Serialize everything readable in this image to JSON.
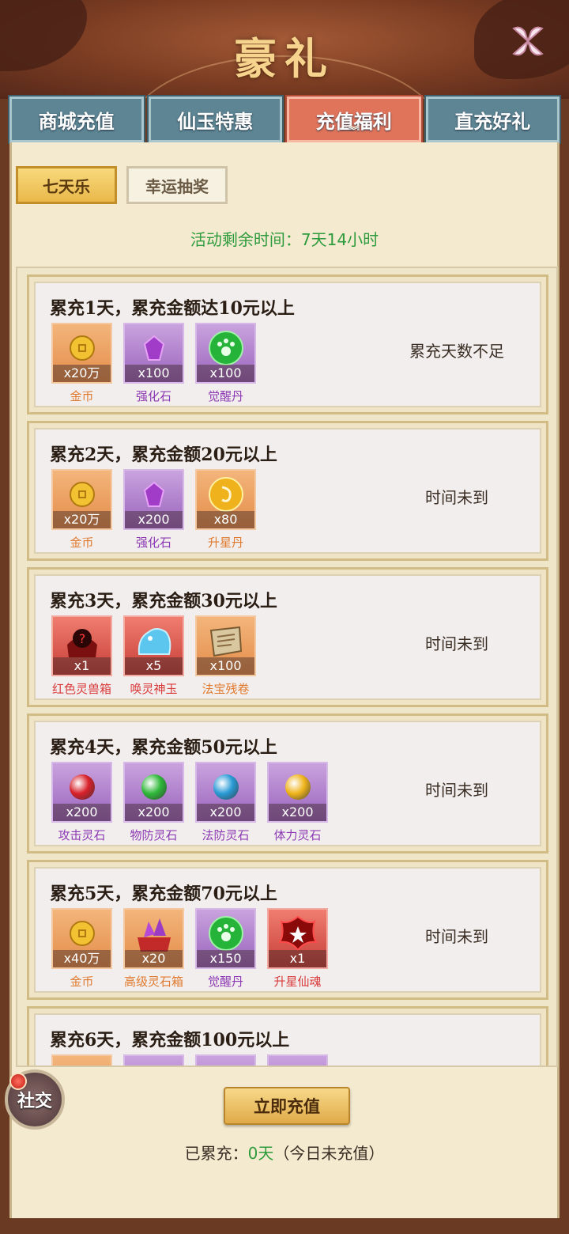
{
  "header": {
    "title": "豪礼"
  },
  "tabs": [
    {
      "label": "商城充值",
      "active": false
    },
    {
      "label": "仙玉特惠",
      "active": false
    },
    {
      "label": "充值福利",
      "active": true
    },
    {
      "label": "直充好礼",
      "active": false
    }
  ],
  "subtabs": [
    {
      "label": "七天乐",
      "active": true
    },
    {
      "label": "幸运抽奖",
      "active": false
    }
  ],
  "remaining": {
    "label": "活动剩余时间：",
    "value": "7天14小时"
  },
  "cards": [
    {
      "title": "累充1天，累充金额达10元以上",
      "status": "累充天数不足",
      "items": [
        {
          "name": "金币",
          "qty": "x20万",
          "bg": "orange",
          "icon": "gold-coin-icon"
        },
        {
          "name": "强化石",
          "qty": "x100",
          "bg": "purple",
          "icon": "enhance-stone-icon"
        },
        {
          "name": "觉醒丹",
          "qty": "x100",
          "bg": "purple",
          "icon": "awaken-pill-icon"
        }
      ]
    },
    {
      "title": "累充2天，累充金额20元以上",
      "status": "时间未到",
      "items": [
        {
          "name": "金币",
          "qty": "x20万",
          "bg": "orange",
          "icon": "gold-coin-icon"
        },
        {
          "name": "强化石",
          "qty": "x200",
          "bg": "purple",
          "icon": "enhance-stone-icon"
        },
        {
          "name": "升星丹",
          "qty": "x80",
          "bg": "orange",
          "icon": "star-pill-icon"
        }
      ]
    },
    {
      "title": "累充3天，累充金额30元以上",
      "status": "时间未到",
      "items": [
        {
          "name": "红色灵兽箱",
          "qty": "x1",
          "bg": "red",
          "icon": "beast-chest-icon"
        },
        {
          "name": "唤灵神玉",
          "qty": "x5",
          "bg": "red",
          "icon": "spirit-jade-icon"
        },
        {
          "name": "法宝残卷",
          "qty": "x100",
          "bg": "orange",
          "icon": "scroll-icon"
        }
      ]
    },
    {
      "title": "累充4天，累充金额50元以上",
      "status": "时间未到",
      "items": [
        {
          "name": "攻击灵石",
          "qty": "x200",
          "bg": "purple",
          "icon": "attack-gem-icon",
          "gem": "#d8202a"
        },
        {
          "name": "物防灵石",
          "qty": "x200",
          "bg": "purple",
          "icon": "defense-gem-icon",
          "gem": "#2fb83a"
        },
        {
          "name": "法防灵石",
          "qty": "x200",
          "bg": "purple",
          "icon": "magic-defense-gem-icon",
          "gem": "#2a9bd6"
        },
        {
          "name": "体力灵石",
          "qty": "x200",
          "bg": "purple",
          "icon": "stamina-gem-icon",
          "gem": "#f0b41c"
        }
      ]
    },
    {
      "title": "累充5天，累充金额70元以上",
      "status": "时间未到",
      "items": [
        {
          "name": "金币",
          "qty": "x40万",
          "bg": "orange",
          "icon": "gold-coin-icon"
        },
        {
          "name": "高级灵石箱",
          "qty": "x20",
          "bg": "orange",
          "icon": "gem-chest-icon"
        },
        {
          "name": "觉醒丹",
          "qty": "x150",
          "bg": "purple",
          "icon": "awaken-pill-icon"
        },
        {
          "name": "升星仙魂",
          "qty": "x1",
          "bg": "red",
          "icon": "star-soul-icon"
        }
      ]
    },
    {
      "title": "累充6天，累充金额100元以上",
      "status": "",
      "items": [
        {
          "name": "",
          "qty": "",
          "bg": "orange",
          "icon": "item-icon"
        },
        {
          "name": "",
          "qty": "",
          "bg": "purple",
          "icon": "item-icon"
        },
        {
          "name": "",
          "qty": "",
          "bg": "purple",
          "icon": "item-icon"
        },
        {
          "name": "",
          "qty": "",
          "bg": "purple",
          "icon": "item-icon"
        }
      ]
    }
  ],
  "recharge_button": "立即充值",
  "accumulated": {
    "label": "已累充：",
    "value": "0天",
    "note": "（今日未充值）"
  },
  "social_button": "社交",
  "colors": {
    "accent_green": "#2e9b3c",
    "tab_active": "#e0745b",
    "tab_inactive": "#5d8593"
  }
}
